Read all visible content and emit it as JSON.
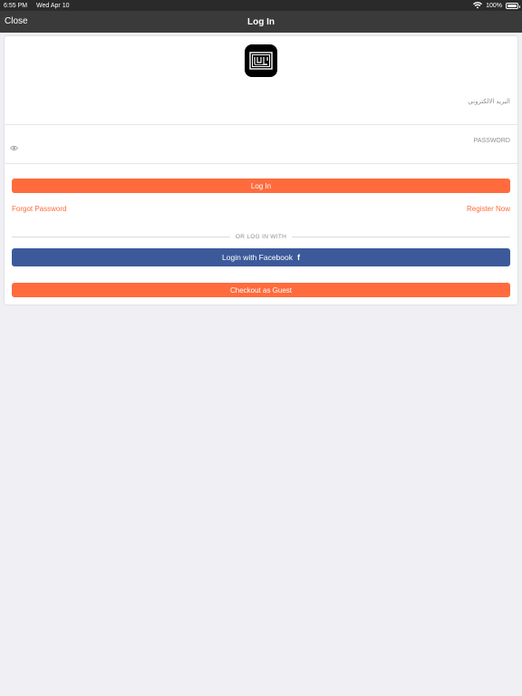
{
  "status_bar": {
    "time": "6:55 PM",
    "date": "Wed Apr 10",
    "battery": "100%"
  },
  "nav": {
    "close_label": "Close",
    "title": "Log In"
  },
  "form": {
    "email_label": "البريد الالكتروني",
    "password_label": "PASSWORD",
    "email_value": "",
    "password_value": ""
  },
  "actions": {
    "login_label": "Log In",
    "forgot_password": "Forgot Password",
    "register_now": "Register Now",
    "or_login_with": "OR LOG IN WITH",
    "facebook_label": "Login with Facebook",
    "facebook_glyph": "f",
    "guest_label": "Checkout as Guest"
  },
  "colors": {
    "accent": "#ff6b3d",
    "facebook": "#3c5a9a",
    "navbar": "#3a3a3a",
    "background": "#efeff4"
  },
  "icons": {
    "logo": "app-logo-icon",
    "eye": "eye-icon",
    "wifi": "wifi-icon",
    "battery": "battery-icon",
    "facebook": "facebook-icon"
  }
}
